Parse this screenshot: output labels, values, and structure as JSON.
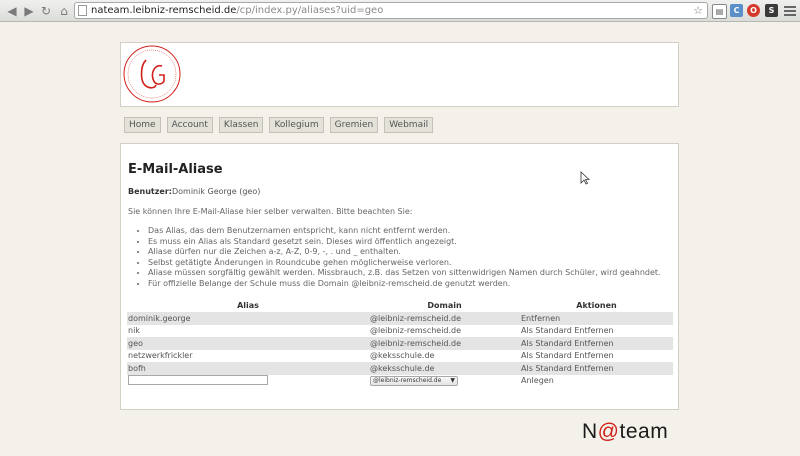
{
  "browser": {
    "url_host": "nateam.leibniz-remscheid.de",
    "url_path": "/cp/index.py/aliases?uid=geo",
    "extensions": [
      {
        "name": "ext-cookie-icon",
        "color": "#5a8fc9",
        "glyph": "C"
      },
      {
        "name": "ext-stop-icon",
        "color": "#d43a2a",
        "glyph": "O"
      },
      {
        "name": "ext-chart-icon",
        "color": "#3a3a3a",
        "glyph": "S"
      }
    ]
  },
  "nav": {
    "items": [
      "Home",
      "Account",
      "Klassen",
      "Kollegium",
      "Gremien",
      "Webmail"
    ]
  },
  "main": {
    "title": "E-Mail-Aliase",
    "user_label": "Benutzer:",
    "user_value": "Dominik George (geo)",
    "intro": "Sie können Ihre E-Mail-Aliase hier selber verwalten. Bitte beachten Sie:",
    "rules": [
      "Das Alias, das dem Benutzernamen entspricht, kann nicht entfernt werden.",
      "Es muss ein Alias als Standard gesetzt sein. Dieses wird öffentlich angezeigt.",
      "Aliase dürfen nur die Zeichen a-z, A-Z, 0-9, -, . und _ enthalten.",
      "Selbst getätigte Änderungen in Roundcube gehen möglicherweise verloren.",
      "Aliase müssen sorgfältig gewählt werden. Missbrauch, z.B. das Setzen von sittenwidrigen Namen durch Schüler, wird geahndet.",
      "Für offizielle Belange der Schule muss die Domain @leibniz-remscheid.de genutzt werden."
    ]
  },
  "table": {
    "headers": [
      "Alias",
      "Domain",
      "Aktionen"
    ],
    "rows": [
      {
        "alias": "dominik.george",
        "domain": "@leibniz-remscheid.de",
        "default_action": "",
        "remove_action": "Entfernen"
      },
      {
        "alias": "nik",
        "domain": "@leibniz-remscheid.de",
        "default_action": "Als Standard",
        "remove_action": "Entfernen"
      },
      {
        "alias": "geo",
        "domain": "@leibniz-remscheid.de",
        "default_action": "Als Standard",
        "remove_action": "Entfernen"
      },
      {
        "alias": "netzwerkfrickler",
        "domain": "@keksschule.de",
        "default_action": "Als Standard",
        "remove_action": "Entfernen"
      },
      {
        "alias": "bofh",
        "domain": "@keksschule.de",
        "default_action": "Als Standard",
        "remove_action": "Entfernen"
      }
    ],
    "new_alias_value": "",
    "new_domain_selected": "@leibniz-remscheid.de",
    "create_label": "Anlegen"
  },
  "brand": {
    "prefix": "N",
    "at": "@",
    "suffix": "team"
  },
  "colors": {
    "accent": "#d0201a",
    "row_shade": "#e4e4e4"
  }
}
